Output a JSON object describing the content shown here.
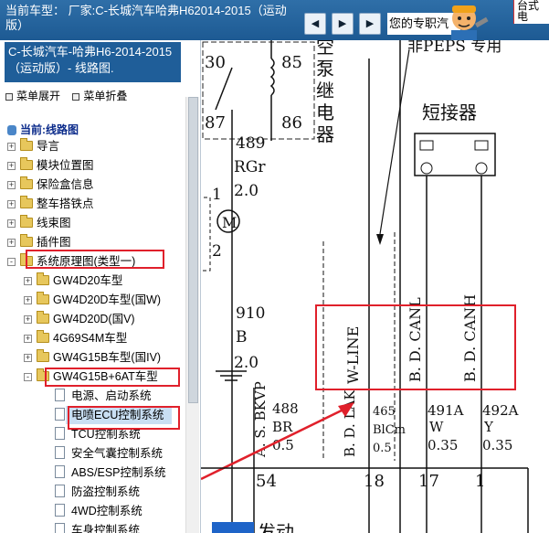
{
  "topbar": {
    "current_model_text": "当前车型： 厂家:C-长城汽车哈弗H62014-2015（运动版）",
    "nav_buttons": [
      "◀",
      "▶",
      "▶"
    ],
    "expert_text": "您的专职汽",
    "promo_text": "台式电"
  },
  "sidebar": {
    "model_box": "C-长城汽车-哈弗H6-2014-2015（运动版）- 线路图.",
    "menu_expand": "菜单展开",
    "menu_collapse": "菜单折叠",
    "tree_title": "当前:线路图",
    "items": [
      {
        "label": "导言",
        "level": 1,
        "expand": "+",
        "icon": "folder-icon"
      },
      {
        "label": "模块位置图",
        "level": 1,
        "expand": "+",
        "icon": "folder-icon"
      },
      {
        "label": "保险盒信息",
        "level": 1,
        "expand": "+",
        "icon": "folder-icon"
      },
      {
        "label": "整车搭铁点",
        "level": 1,
        "expand": "+",
        "icon": "folder-icon"
      },
      {
        "label": "线束图",
        "level": 1,
        "expand": "+",
        "icon": "folder-icon"
      },
      {
        "label": "插件图",
        "level": 1,
        "expand": "+",
        "icon": "folder-icon"
      },
      {
        "label": "系统原理图(类型一)",
        "level": 1,
        "expand": "-",
        "icon": "folder-icon"
      },
      {
        "label": "GW4D20车型",
        "level": 2,
        "expand": "+",
        "icon": "folder-icon"
      },
      {
        "label": "GW4D20D车型(国W)",
        "level": 2,
        "expand": "+",
        "icon": "folder-icon"
      },
      {
        "label": "GW4D20D(国V)",
        "level": 2,
        "expand": "+",
        "icon": "folder-icon"
      },
      {
        "label": "4G69S4M车型",
        "level": 2,
        "expand": "+",
        "icon": "folder-icon"
      },
      {
        "label": "GW4G15B车型(国IV)",
        "level": 2,
        "expand": "+",
        "icon": "folder-icon"
      },
      {
        "label": "GW4G15B+6AT车型",
        "level": 2,
        "expand": "-",
        "icon": "folder-icon"
      },
      {
        "label": "电源、启动系统",
        "level": 3,
        "icon": "page-icon"
      },
      {
        "label": "电喷ECU控制系统",
        "level": 3,
        "icon": "page-icon",
        "selected": true
      },
      {
        "label": "TCU控制系统",
        "level": 3,
        "icon": "page-icon"
      },
      {
        "label": "安全气囊控制系统",
        "level": 3,
        "icon": "page-icon"
      },
      {
        "label": "ABS/ESP控制系统",
        "level": 3,
        "icon": "page-icon"
      },
      {
        "label": "防盗控制系统",
        "level": 3,
        "icon": "page-icon"
      },
      {
        "label": "4WD控制系统",
        "level": 3,
        "icon": "page-icon"
      },
      {
        "label": "车身控制系统",
        "level": 3,
        "icon": "page-icon"
      }
    ]
  },
  "diagram": {
    "relay_pins": [
      "30",
      "85",
      "87",
      "86"
    ],
    "relay_label": "空泵继电器",
    "pbps_label": "非PEPS 专用",
    "short_connector_label": "短接器",
    "wire_489": {
      "num": "489",
      "color": "RGr",
      "size": "2.0"
    },
    "wire_910": {
      "num": "910",
      "color": "B",
      "size": "2.0"
    },
    "motor_pins": [
      "1",
      "2"
    ],
    "motor_symbol": "M",
    "signals": [
      "W-LINE",
      "B. D. CANL",
      "B. D. CANH"
    ],
    "vertical_labels": [
      "A. S. BKVP",
      "B. D. LAK"
    ],
    "wires": [
      {
        "num": "488",
        "color": "BR",
        "size": "0.5"
      },
      {
        "num": "465",
        "color": "BlCm",
        "size": "0.5"
      },
      {
        "num": "491A",
        "color": "W",
        "size": "0.35"
      },
      {
        "num": "492A",
        "color": "Y",
        "size": "0.35"
      }
    ],
    "pin_numbers": [
      "54",
      "18",
      "17",
      "1"
    ],
    "bottom_text": "发动"
  },
  "colors": {
    "topbar": "#1d5a93",
    "highlight": "#e0202b",
    "selected": "#c9dff3"
  }
}
